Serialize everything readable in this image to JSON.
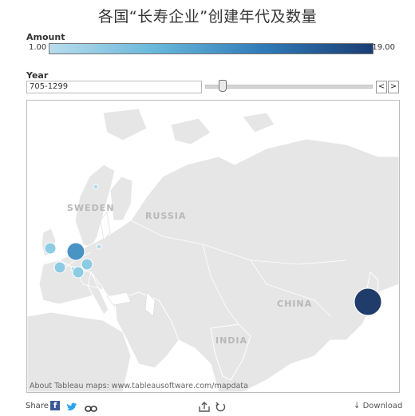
{
  "title": "各国“长寿企业”创建年代及数量",
  "legend": {
    "title": "Amount",
    "min_label": "1.00",
    "max_label": "19.00",
    "color_low": "#b9dcec",
    "color_high": "#1b3d74"
  },
  "filter": {
    "title": "Year",
    "value": "705-1299",
    "prev_label": "<",
    "next_label": ">",
    "slider_position": 0.1
  },
  "map": {
    "country_labels": {
      "sweden": "SWEDEN",
      "russia": "RUSSIA",
      "china": "CHINA",
      "india": "INDIA"
    },
    "credit": "About Tableau maps: www.tableausoftware.com/mapdata"
  },
  "footer": {
    "share_label": "Share",
    "download_label": "Download",
    "icons": [
      "facebook-icon",
      "twitter-icon",
      "link-icon",
      "export-icon",
      "revert-icon",
      "download-icon"
    ]
  }
}
